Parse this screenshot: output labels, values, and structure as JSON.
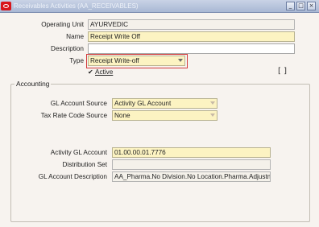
{
  "window": {
    "title": "Receivables Activities (AA_RECEIVABLES)",
    "minimize": "_",
    "maximize": "□",
    "close": "×"
  },
  "header": {
    "operating_unit_label": "Operating Unit",
    "operating_unit_value": "AYURVEDIC",
    "name_label": "Name",
    "name_value": "Receipt Write Off",
    "description_label": "Description",
    "description_value": "",
    "type_label": "Type",
    "type_value": "Receipt Write-off",
    "active_label": "Active",
    "active_checked": true,
    "flexfield": "[ ]"
  },
  "accounting": {
    "group_title": "Accounting",
    "gl_source_label": "GL Account Source",
    "gl_source_value": "Activity GL Account",
    "tax_source_label": "Tax Rate Code Source",
    "tax_source_value": "None",
    "activity_gl_label": "Activity GL Account",
    "activity_gl_value": "01.00.00.01.7776",
    "distribution_set_label": "Distribution Set",
    "distribution_set_value": "",
    "gl_desc_label": "GL Account Description",
    "gl_desc_value": "AA_Pharma.No Division.No Location.Pharma.Adjustm"
  },
  "colors": {
    "required_field": "#fcf3c2",
    "highlight_box": "#d33a3a",
    "brand_icon": "#d8161b"
  }
}
